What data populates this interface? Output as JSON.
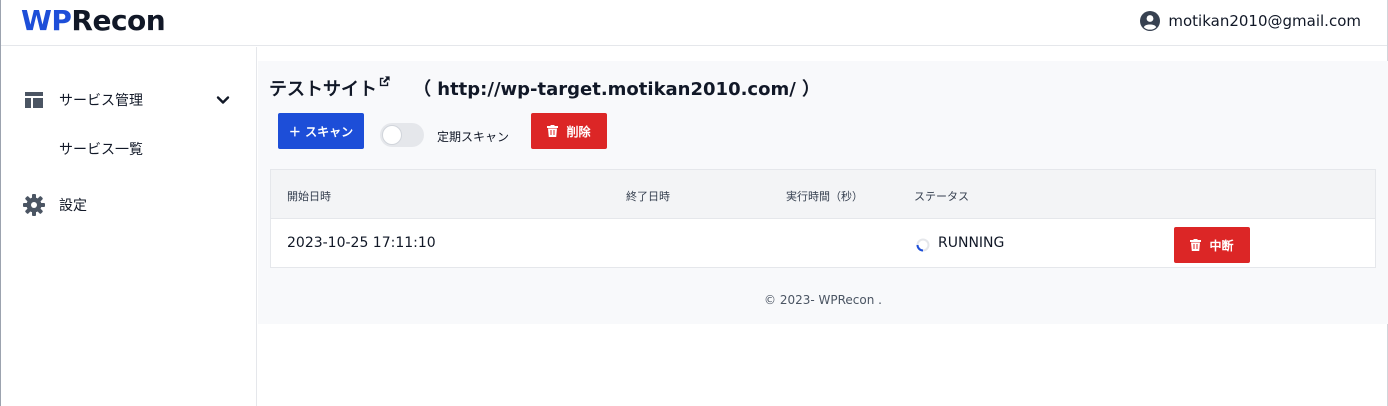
{
  "header": {
    "logo_wp": "WP",
    "logo_recon": "Recon",
    "user_email": "motikan2010@gmail.com"
  },
  "sidebar": {
    "items": [
      {
        "label": "サービス管理",
        "icon": "dashboard-icon"
      },
      {
        "label": "サービス一覧"
      },
      {
        "label": "設定",
        "icon": "gear-icon"
      }
    ]
  },
  "main": {
    "site_name": "テストサイト",
    "site_url": "（ http://wp-target.motikan2010.com/ ）",
    "scan_button": "＋  スキャン",
    "schedule_label": "定期スキャン",
    "delete_button": "削除",
    "table": {
      "headers": [
        "開始日時",
        "終了日時",
        "実行時間（秒）",
        "ステータス"
      ],
      "rows": [
        {
          "start": "2023-10-25 17:11:10",
          "end": "",
          "duration": "",
          "status": "RUNNING",
          "action": "中断"
        }
      ]
    },
    "footer": "© 2023- WPRecon ."
  },
  "colors": {
    "brand": "#1d4ed8",
    "danger": "#dc2626"
  },
  "schedule_enabled": false
}
